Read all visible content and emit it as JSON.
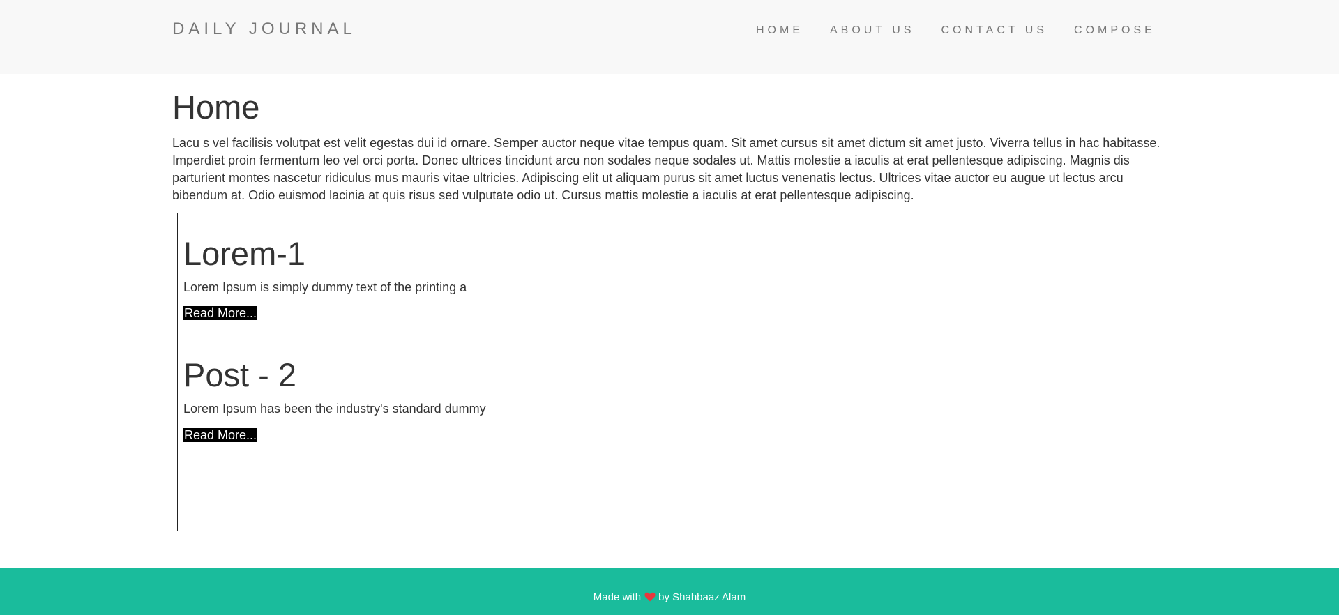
{
  "navbar": {
    "brand": "DAILY JOURNAL",
    "links": [
      {
        "label": "HOME"
      },
      {
        "label": "ABOUT US"
      },
      {
        "label": "CONTACT US"
      },
      {
        "label": "COMPOSE"
      }
    ]
  },
  "main": {
    "title": "Home",
    "intro": "Lacu s vel facilisis volutpat est velit egestas dui id ornare. Semper auctor neque vitae tempus quam. Sit amet cursus sit amet dictum sit amet justo. Viverra tellus in hac habitasse. Imperdiet proin fermentum leo vel orci porta. Donec ultrices tincidunt arcu non sodales neque sodales ut. Mattis molestie a iaculis at erat pellentesque adipiscing. Magnis dis parturient montes nascetur ridiculus mus mauris vitae ultricies. Adipiscing elit ut aliquam purus sit amet luctus venenatis lectus. Ultrices vitae auctor eu augue ut lectus arcu bibendum at. Odio euismod lacinia at quis risus sed vulputate odio ut. Cursus mattis molestie a iaculis at erat pellentesque adipiscing.",
    "posts": [
      {
        "title": "Lorem-1",
        "excerpt": "Lorem Ipsum is simply dummy text of the printing a",
        "read_more": "Read More..."
      },
      {
        "title": "Post - 2",
        "excerpt": "Lorem Ipsum has been the industry's standard dummy",
        "read_more": "Read More..."
      }
    ]
  },
  "footer": {
    "prefix": "Made with",
    "icon": "heart-icon",
    "suffix": "by Shahbaaz Alam"
  },
  "colors": {
    "navbar_bg": "#f8f8f8",
    "footer_bg": "#1abc9c",
    "heart": "#e8383d",
    "read_more_bg": "#000000"
  }
}
